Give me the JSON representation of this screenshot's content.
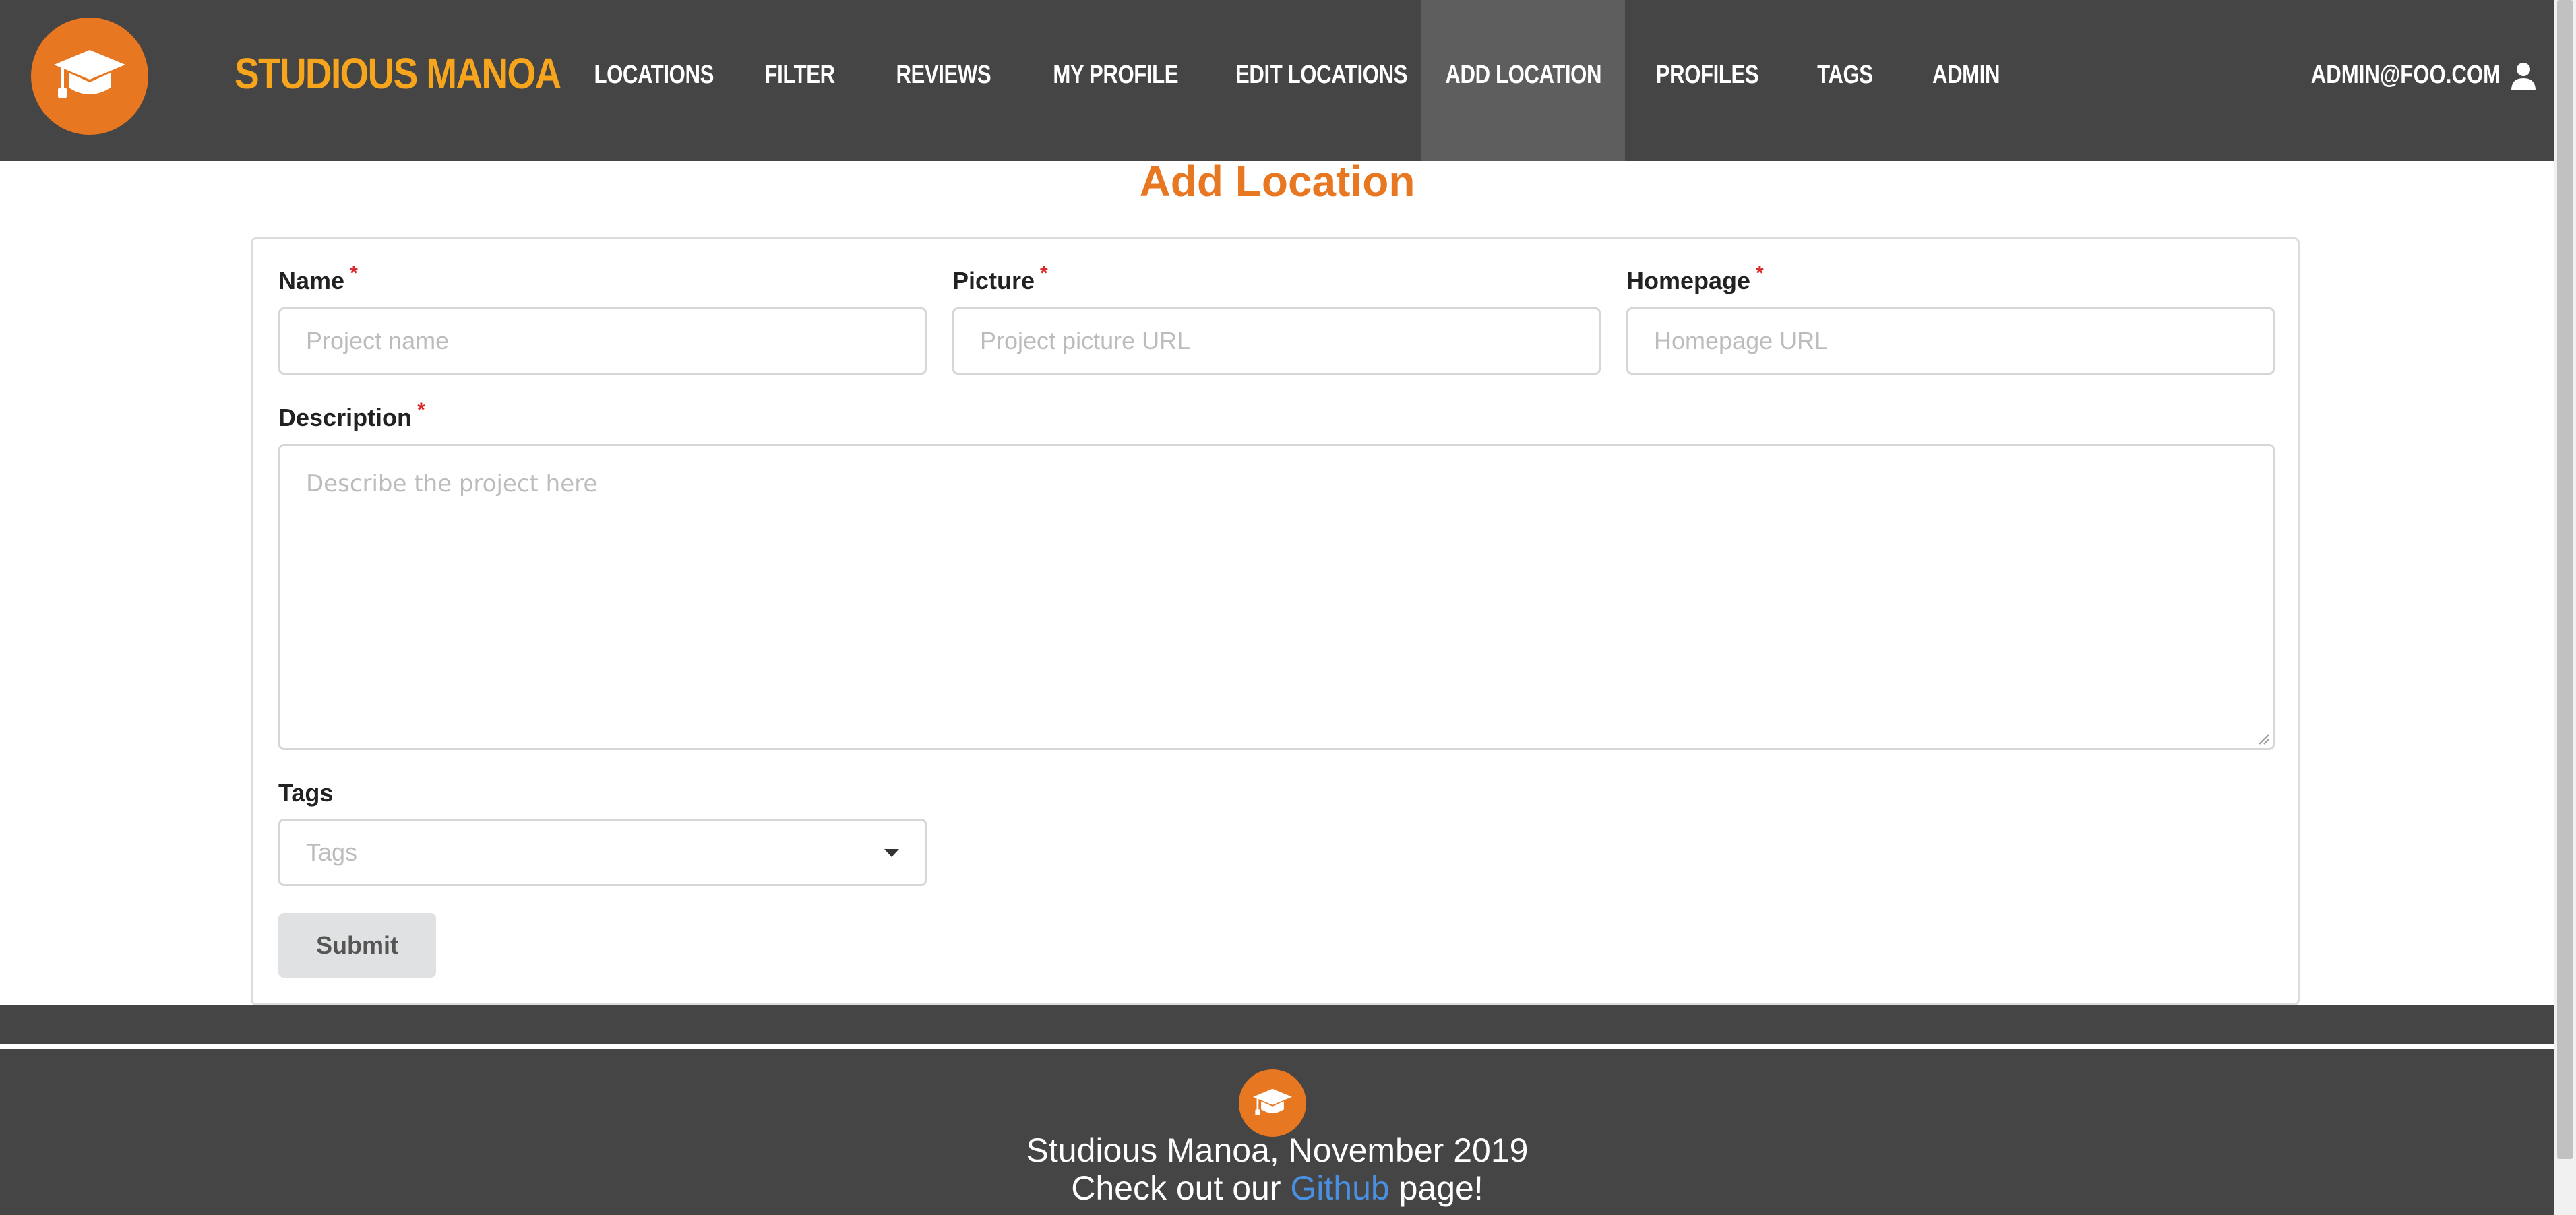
{
  "brand": {
    "name": "STUDIOUS MANOA",
    "logo_icon": "graduation-cap-icon",
    "accent": "#e87722",
    "brand_color": "#f7a51c"
  },
  "nav": {
    "items": [
      {
        "label": "LOCATIONS"
      },
      {
        "label": "FILTER"
      },
      {
        "label": "REVIEWS"
      },
      {
        "label": "MY PROFILE"
      },
      {
        "label": "EDIT LOCATIONS"
      },
      {
        "label": "ADD LOCATION",
        "active": true
      },
      {
        "label": "PROFILES"
      },
      {
        "label": "TAGS"
      },
      {
        "label": "ADMIN"
      }
    ],
    "user": {
      "email": "ADMIN@FOO.COM",
      "icon": "user-icon"
    }
  },
  "page": {
    "title": "Add Location"
  },
  "form": {
    "required_mark": "*",
    "name": {
      "label": "Name",
      "placeholder": "Project name",
      "value": ""
    },
    "picture": {
      "label": "Picture",
      "placeholder": "Project picture URL",
      "value": ""
    },
    "homepage": {
      "label": "Homepage",
      "placeholder": "Homepage URL",
      "value": ""
    },
    "description": {
      "label": "Description",
      "placeholder": "Describe the project here",
      "value": ""
    },
    "tags": {
      "label": "Tags",
      "placeholder": "Tags"
    },
    "submit_label": "Submit"
  },
  "footer": {
    "line1": "Studious Manoa, November 2019",
    "line2_prefix": "Check out our ",
    "link_text": "Github",
    "line2_suffix": " page!",
    "link_color": "#4a90e2"
  }
}
